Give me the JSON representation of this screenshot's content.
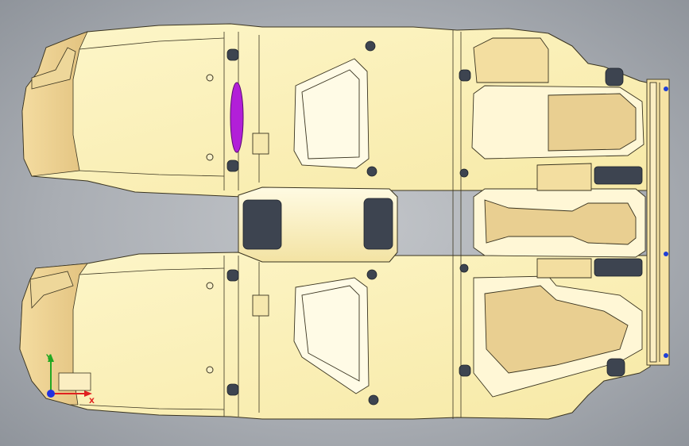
{
  "viewport": {
    "name": "cad-graphics-area",
    "background_top": "#c3c6ca",
    "background_bottom": "#8f949b"
  },
  "model": {
    "part": "vehicle-floor-pan",
    "body_color": "#fbf0b5",
    "shade_color": "#e8c98a",
    "edge_color": "#3a3420",
    "highlight_color": "#b21fd8",
    "fastener_color": "#3d4450",
    "bracket_dot_color": "#1f3fd6"
  },
  "triad": {
    "x_axis": "X",
    "y_axis": "Y",
    "x_color": "#e02020",
    "y_color": "#22a822",
    "z_color": "#2030e0"
  }
}
